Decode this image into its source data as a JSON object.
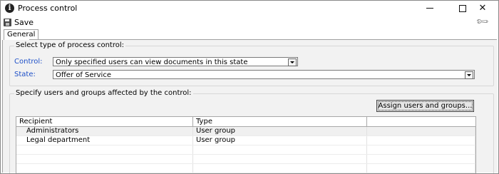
{
  "window": {
    "title": "Process control",
    "app_icon_glyph": "i",
    "icon": "info-icon"
  },
  "toolbar": {
    "save_label": "Save",
    "save_icon": "floppy-disk-icon",
    "settings_icon": "wrench-icon"
  },
  "tabs": [
    {
      "label": "General",
      "active": true
    }
  ],
  "process_control_group": {
    "legend": "Select type of process control:",
    "control_label": "Control:",
    "control_value": "Only specified users can view documents in this state",
    "state_label": "State:",
    "state_value": "Offer of Service"
  },
  "users_group": {
    "legend": "Specify users and groups affected by the control:",
    "assign_button": "Assign users and groups...",
    "columns": [
      "Recipient",
      "Type"
    ],
    "rows": [
      {
        "recipient": "Administrators",
        "type": "User group"
      },
      {
        "recipient": "Legal department",
        "type": "User group"
      }
    ]
  },
  "colors": {
    "label_blue": "#1e50c8",
    "panel_bg": "#f2f2f2"
  }
}
